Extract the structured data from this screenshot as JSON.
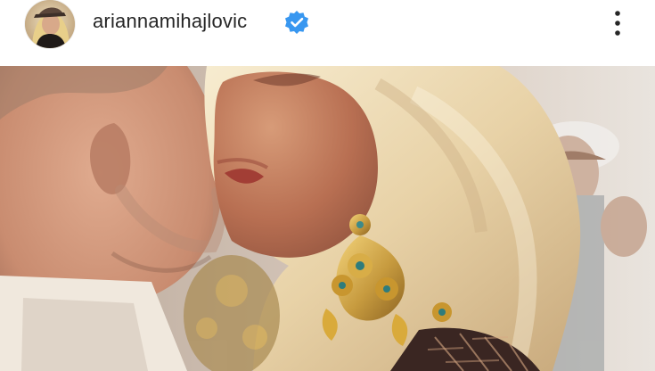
{
  "post": {
    "username": "ariannamihajlovic",
    "verified": true,
    "menu_icon": "more-vertical-icon",
    "image_description_icon": "photo"
  },
  "colors": {
    "verified": "#3897f0",
    "text": "#262626"
  }
}
